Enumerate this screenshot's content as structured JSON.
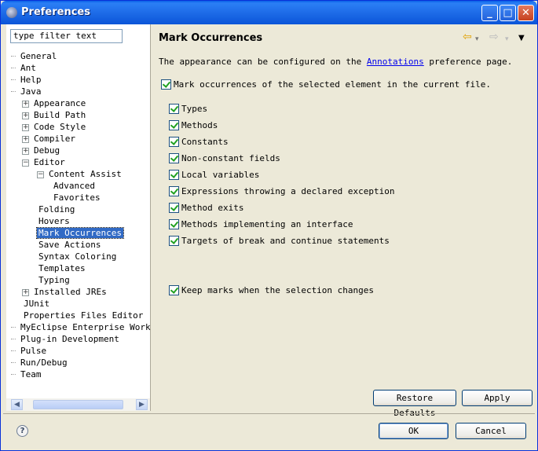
{
  "window": {
    "title": "Preferences"
  },
  "filter": {
    "value": "type filter text"
  },
  "tree": [
    {
      "label": "General",
      "level": 0,
      "icon": "tick"
    },
    {
      "label": "Ant",
      "level": 0,
      "icon": "tick"
    },
    {
      "label": "Help",
      "level": 0,
      "icon": "tick"
    },
    {
      "label": "Java",
      "level": 0,
      "icon": "tick"
    },
    {
      "label": "Appearance",
      "level": 1,
      "icon": "plus"
    },
    {
      "label": "Build Path",
      "level": 1,
      "icon": "plus"
    },
    {
      "label": "Code Style",
      "level": 1,
      "icon": "plus"
    },
    {
      "label": "Compiler",
      "level": 1,
      "icon": "plus"
    },
    {
      "label": "Debug",
      "level": 1,
      "icon": "plus"
    },
    {
      "label": "Editor",
      "level": 1,
      "icon": "minus"
    },
    {
      "label": "Content Assist",
      "level": 2,
      "icon": "minus"
    },
    {
      "label": "Advanced",
      "level": 3,
      "icon": "none"
    },
    {
      "label": "Favorites",
      "level": 3,
      "icon": "none"
    },
    {
      "label": "Folding",
      "level": 2,
      "icon": "none"
    },
    {
      "label": "Hovers",
      "level": 2,
      "icon": "none"
    },
    {
      "label": "Mark Occurrences",
      "level": 2,
      "icon": "none",
      "selected": true
    },
    {
      "label": "Save Actions",
      "level": 2,
      "icon": "none"
    },
    {
      "label": "Syntax Coloring",
      "level": 2,
      "icon": "none"
    },
    {
      "label": "Templates",
      "level": 2,
      "icon": "none"
    },
    {
      "label": "Typing",
      "level": 2,
      "icon": "none"
    },
    {
      "label": "Installed JREs",
      "level": 1,
      "icon": "plus"
    },
    {
      "label": "JUnit",
      "level": 1,
      "icon": "none"
    },
    {
      "label": "Properties Files Editor",
      "level": 1,
      "icon": "none"
    },
    {
      "label": "MyEclipse Enterprise Workbench",
      "level": 0,
      "icon": "tick"
    },
    {
      "label": "Plug-in Development",
      "level": 0,
      "icon": "tick"
    },
    {
      "label": "Pulse",
      "level": 0,
      "icon": "tick"
    },
    {
      "label": "Run/Debug",
      "level": 0,
      "icon": "tick"
    },
    {
      "label": "Team",
      "level": 0,
      "icon": "tick"
    }
  ],
  "page": {
    "title": "Mark Occurrences",
    "desc_prefix": "The appearance can be configured on the ",
    "desc_link": "Annotations",
    "desc_suffix": " preference page.",
    "main_option": "Mark occurrences of the selected element in the current file.",
    "options": [
      "Types",
      "Methods",
      "Constants",
      "Non-constant fields",
      "Local variables",
      "Expressions throwing a declared exception",
      "Method exits",
      "Methods implementing an interface",
      "Targets of break and continue statements"
    ],
    "keep_option": "Keep marks when the selection changes"
  },
  "buttons": {
    "restore": "Restore Defaults",
    "apply": "Apply",
    "ok": "OK",
    "cancel": "Cancel",
    "help": "?"
  },
  "nav": {
    "back": "⇦",
    "forward": "⇨",
    "menu": "▼",
    "dropdown": "▾"
  }
}
